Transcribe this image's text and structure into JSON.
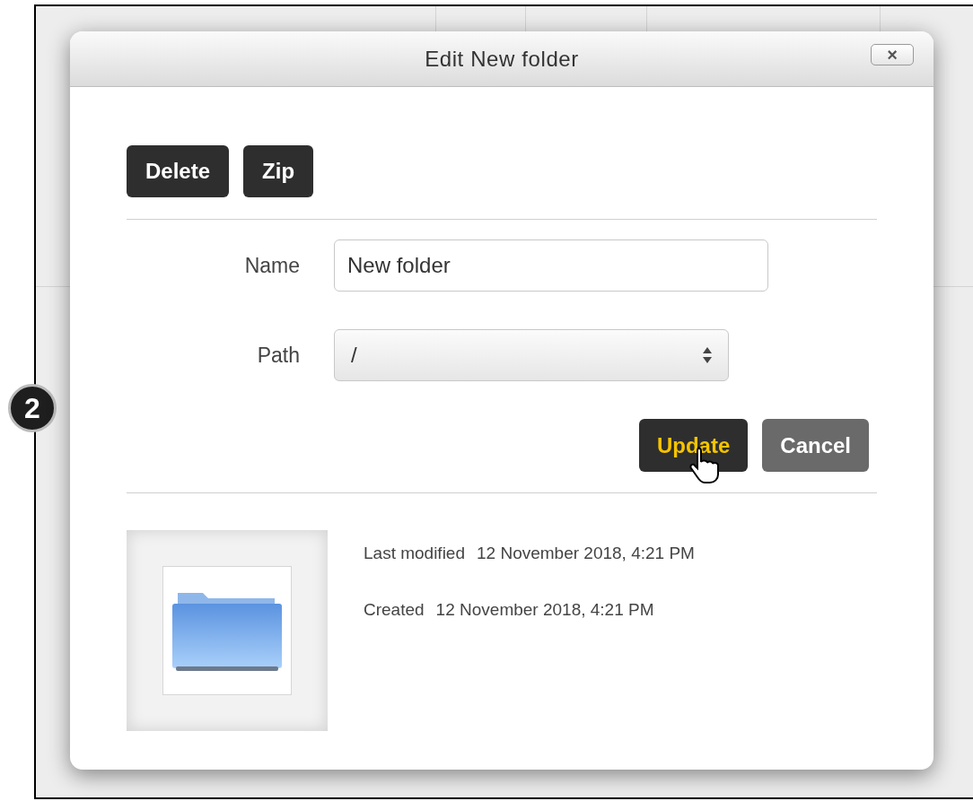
{
  "callout": {
    "label": "2"
  },
  "dialog": {
    "title": "Edit New folder",
    "close_label": "×",
    "actions": [
      {
        "label": "Delete"
      },
      {
        "label": "Zip"
      }
    ],
    "fields": [
      {
        "kind": "text",
        "label": "Name",
        "value": "New folder"
      },
      {
        "kind": "select",
        "label": "Path",
        "value": "/"
      }
    ],
    "buttons": [
      {
        "kind": "primary",
        "label": "Update",
        "hovered": true
      },
      {
        "kind": "secondary",
        "label": "Cancel",
        "hovered": false
      }
    ],
    "info": [
      {
        "label": "Last modified",
        "value": "12 November 2018, 4:21 PM"
      },
      {
        "label": "Created",
        "value": "12 November 2018, 4:21 PM"
      }
    ]
  }
}
